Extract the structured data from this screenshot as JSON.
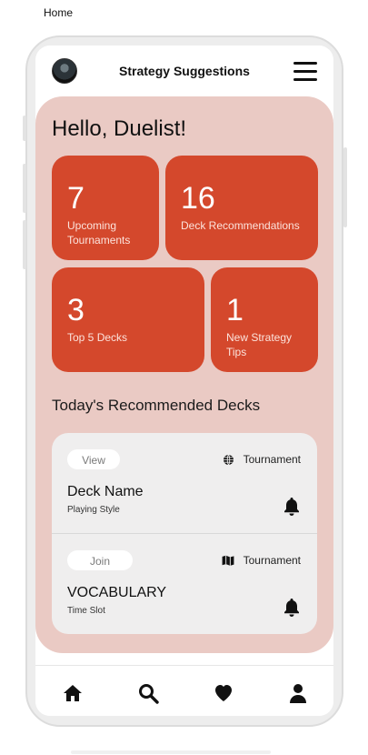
{
  "frame_label": "Home",
  "header": {
    "title": "Strategy Suggestions",
    "avatar": "user-avatar",
    "menu_icon": "hamburger-menu-icon"
  },
  "greeting": "Hello, Duelist!",
  "stats": [
    {
      "value": "7",
      "label": "Upcoming Tournaments"
    },
    {
      "value": "16",
      "label": "Deck Recommendations"
    },
    {
      "value": "3",
      "label": "Top 5 Decks"
    },
    {
      "value": "1",
      "label": "New Strategy Tips"
    }
  ],
  "section_title": "Today's Recommended Decks",
  "decks": [
    {
      "action": "View",
      "tag_icon": "globe-icon",
      "tag": "Tournament",
      "name": "Deck Name",
      "subtitle": "Playing Style",
      "bell_icon": "bell-icon"
    },
    {
      "action": "Join",
      "tag_icon": "map-icon",
      "tag": "Tournament",
      "name": "VOCABULARY",
      "subtitle": "Time Slot",
      "bell_icon": "bell-icon"
    }
  ],
  "nav": [
    "home-icon",
    "search-icon",
    "heart-icon",
    "profile-icon"
  ],
  "colors": {
    "accent": "#d4482c",
    "panel": "#eacac4",
    "list": "#efeeee"
  }
}
